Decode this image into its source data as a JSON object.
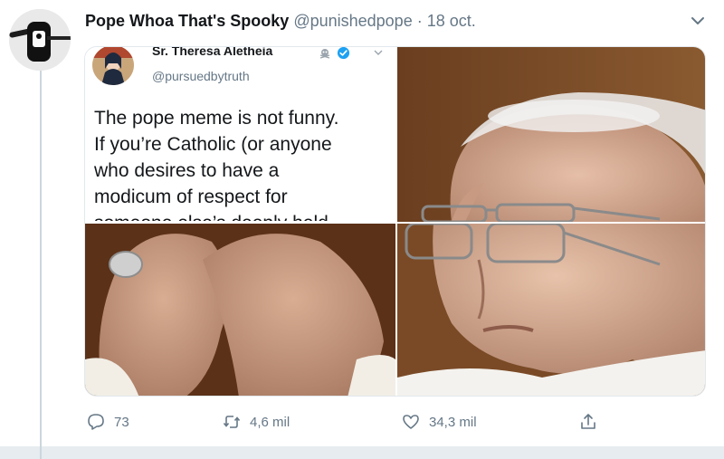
{
  "tweet": {
    "author_name": "Pope Whoa That's Spooky",
    "author_handle": "@punishedpope",
    "separator": "·",
    "date": "18 oct.",
    "avatar_icon": "cassette-avatar-icon",
    "more_icon": "chevron-down-icon"
  },
  "embedded_tweet": {
    "author_name": "Sr. Theresa Aletheia",
    "author_handle": "@pursuedbytruth",
    "badge_icon": "skull-crossbones-icon",
    "verified_icon": "verified-badge-icon",
    "text_lines": [
      "The pope meme is not funny.",
      "If you’re Catholic (or anyone",
      "who desires to have a",
      "modicum of respect for",
      "someone else’s deeply held"
    ]
  },
  "actions": {
    "replies": "73",
    "retweets": "4,6 mil",
    "likes": "34,3 mil",
    "reply_icon": "reply-icon",
    "retweet_icon": "retweet-icon",
    "like_icon": "heart-icon",
    "share_icon": "share-icon"
  },
  "colors": {
    "text_primary": "#14171a",
    "text_secondary": "#657786",
    "verified_blue": "#1da1f2",
    "border": "#e1e8ed",
    "thread_line": "#ccd6dd"
  }
}
